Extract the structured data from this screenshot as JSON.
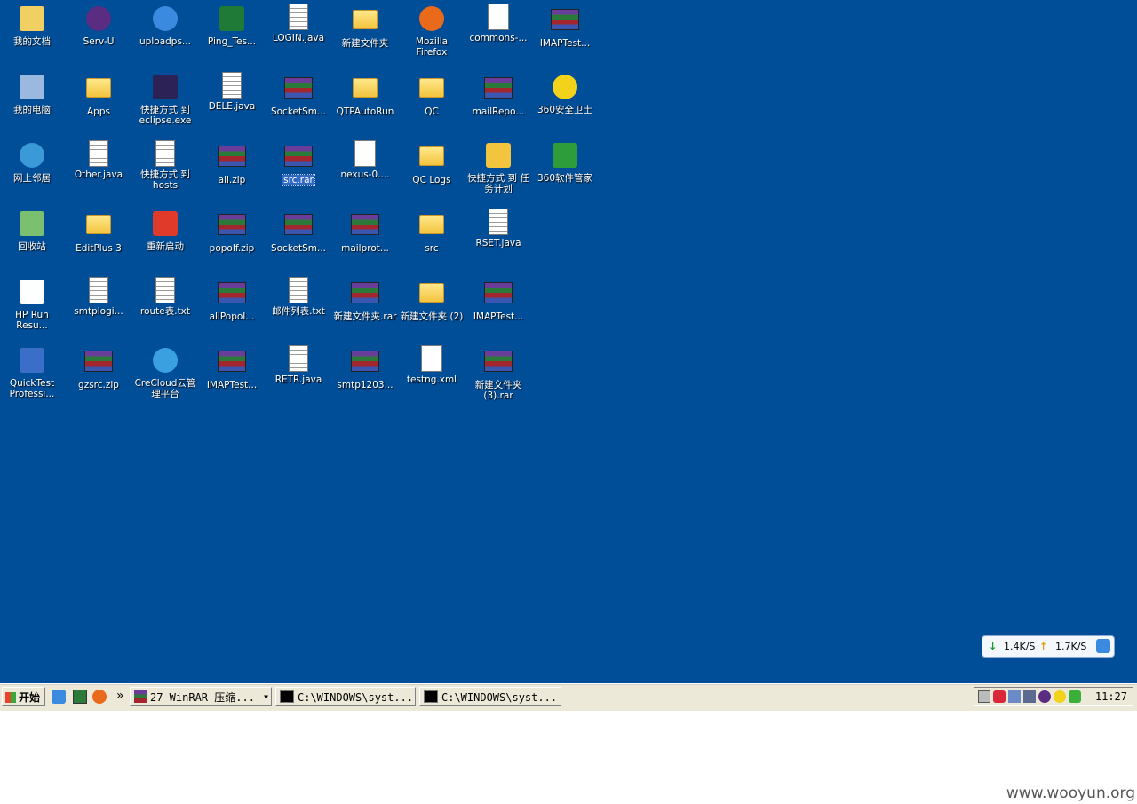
{
  "desktop": {
    "icons": [
      {
        "label": "我的文档",
        "glyph": "my-documents-icon",
        "color": "#f0d060"
      },
      {
        "label": "Serv-U",
        "glyph": "serv-u-icon",
        "color": "#5a2d82"
      },
      {
        "label": "uploadps...",
        "glyph": "internet-explorer-icon",
        "color": "#3a8be0"
      },
      {
        "label": "Ping_Tes...",
        "glyph": "excel-file-icon",
        "color": "#1e7a36"
      },
      {
        "label": "LOGIN.java",
        "glyph": "text-file-icon",
        "color": "#ffffff"
      },
      {
        "label": "新建文件夹",
        "glyph": "folder-icon",
        "color": "#f3c43e"
      },
      {
        "label": "Mozilla Firefox",
        "glyph": "firefox-icon",
        "color": "#e86a1a"
      },
      {
        "label": "commons-...",
        "glyph": "java-file-icon",
        "color": "#ffffff"
      },
      {
        "label": "IMAPTest...",
        "glyph": "winrar-archive-icon",
        "color": "#6a3d9a"
      },
      {
        "label": "我的电脑",
        "glyph": "my-computer-icon",
        "color": "#9ab8e0"
      },
      {
        "label": "Apps",
        "glyph": "folder-icon",
        "color": "#f3c43e"
      },
      {
        "label": "快捷方式 到 eclipse.exe",
        "glyph": "eclipse-icon",
        "color": "#2c2255"
      },
      {
        "label": "DELE.java",
        "glyph": "text-file-icon",
        "color": "#ffffff"
      },
      {
        "label": "SocketSm...",
        "glyph": "winrar-archive-icon",
        "color": "#6a3d9a"
      },
      {
        "label": "QTPAutoRun",
        "glyph": "folder-icon",
        "color": "#f3c43e"
      },
      {
        "label": "QC",
        "glyph": "folder-icon",
        "color": "#f3c43e"
      },
      {
        "label": "mailRepo...",
        "glyph": "winrar-archive-icon",
        "color": "#6a3d9a"
      },
      {
        "label": "360安全卫士",
        "glyph": "360-safeguard-icon",
        "color": "#f2d21a"
      },
      {
        "label": "网上邻居",
        "glyph": "network-places-icon",
        "color": "#3a9ad8"
      },
      {
        "label": "Other.java",
        "glyph": "text-file-icon",
        "color": "#ffffff"
      },
      {
        "label": "快捷方式 到 hosts",
        "glyph": "hosts-file-icon",
        "color": "#ffffff"
      },
      {
        "label": "all.zip",
        "glyph": "winrar-archive-icon",
        "color": "#6a3d9a"
      },
      {
        "label": "src.rar",
        "glyph": "winrar-archive-icon",
        "color": "#6a3d9a",
        "selected": true
      },
      {
        "label": "nexus-0....",
        "glyph": "java-file-icon",
        "color": "#ffffff"
      },
      {
        "label": "QC Logs",
        "glyph": "folder-icon",
        "color": "#f3c43e"
      },
      {
        "label": "快捷方式 到 任务计划",
        "glyph": "scheduled-tasks-icon",
        "color": "#f3c43e"
      },
      {
        "label": "360软件管家",
        "glyph": "360-software-manager-icon",
        "color": "#2d9c3a"
      },
      {
        "label": "回收站",
        "glyph": "recycle-bin-icon",
        "color": "#7ac070"
      },
      {
        "label": "EditPlus 3",
        "glyph": "folder-icon",
        "color": "#f3c43e"
      },
      {
        "label": "重新启动",
        "glyph": "restart-icon",
        "color": "#e03a2a"
      },
      {
        "label": "popoIf.zip",
        "glyph": "winrar-archive-icon",
        "color": "#6a3d9a"
      },
      {
        "label": "SocketSm...",
        "glyph": "winrar-archive-icon",
        "color": "#6a3d9a"
      },
      {
        "label": "mailprot...",
        "glyph": "winrar-archive-icon",
        "color": "#6a3d9a"
      },
      {
        "label": "src",
        "glyph": "folder-icon",
        "color": "#f3c43e"
      },
      {
        "label": "RSET.java",
        "glyph": "text-file-icon",
        "color": "#ffffff"
      },
      {
        "label": "HP Run Resu...",
        "glyph": "hp-run-results-icon",
        "color": "#ffffff"
      },
      {
        "label": "smtplogi...",
        "glyph": "document-icon",
        "color": "#ffffff"
      },
      {
        "label": "route表.txt",
        "glyph": "text-file-icon",
        "color": "#ffffff"
      },
      {
        "label": "allPopoI...",
        "glyph": "winrar-archive-icon",
        "color": "#6a3d9a"
      },
      {
        "label": "邮件列表.txt",
        "glyph": "text-file-icon",
        "color": "#ffffff"
      },
      {
        "label": "新建文件夹.rar",
        "glyph": "winrar-archive-icon",
        "color": "#6a3d9a"
      },
      {
        "label": "新建文件夹 (2)",
        "glyph": "folder-icon",
        "color": "#f3c43e"
      },
      {
        "label": "IMAPTest...",
        "glyph": "winrar-archive-icon",
        "color": "#6a3d9a"
      },
      {
        "label": "QuickTest Professi...",
        "glyph": "quicktest-icon",
        "color": "#3a6ec8"
      },
      {
        "label": "gzsrc.zip",
        "glyph": "winrar-archive-icon",
        "color": "#6a3d9a"
      },
      {
        "label": "CreCloud云管理平台",
        "glyph": "crecloud-icon",
        "color": "#3aa0e0"
      },
      {
        "label": "IMAPTest...",
        "glyph": "winrar-archive-icon",
        "color": "#6a3d9a"
      },
      {
        "label": "RETR.java",
        "glyph": "text-file-icon",
        "color": "#ffffff"
      },
      {
        "label": "smtp1203...",
        "glyph": "winrar-archive-icon",
        "color": "#6a3d9a"
      },
      {
        "label": "testng.xml",
        "glyph": "xml-file-icon",
        "color": "#ffffff"
      },
      {
        "label": "新建文件夹(3).rar",
        "glyph": "winrar-archive-icon",
        "color": "#6a3d9a"
      }
    ]
  },
  "netspeed": {
    "down": "1.4K/S",
    "up": "1.7K/S"
  },
  "taskbar": {
    "start_label": "开始",
    "more_label": "»",
    "tasks": [
      {
        "label": "27 WinRAR 压缩...",
        "icon": "winrar-icon"
      },
      {
        "label": "C:\\WINDOWS\\syst...",
        "icon": "cmd-icon"
      },
      {
        "label": "C:\\WINDOWS\\syst...",
        "icon": "cmd-icon"
      }
    ],
    "clock": "11:27"
  },
  "watermark": "www.wooyun.org"
}
